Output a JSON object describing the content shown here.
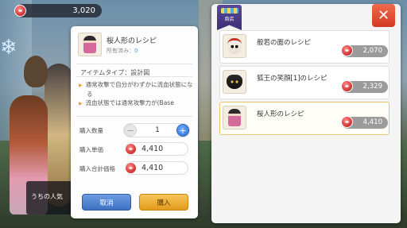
{
  "currency": {
    "amount": "3,020"
  },
  "chat": {
    "text": "うちの人気"
  },
  "detail": {
    "title": "桜人形のレシピ",
    "owned_label": "所有済み：",
    "owned_value": "0",
    "type": "アイテムタイプ：設計図",
    "description_lines": [
      "通常攻撃で自分がわずかに流血状態になる",
      "流血状態では通常攻撃力が(Base"
    ],
    "quantity_label": "購入数量",
    "quantity_value": "1",
    "unit_price_label": "購入単価",
    "unit_price_value": "4,410",
    "total_price_label": "購入合計価格",
    "total_price_value": "4,410",
    "cancel_label": "取消",
    "buy_label": "購入"
  },
  "shop": {
    "badge_label": "商店",
    "close_symbol": "✕",
    "items": [
      {
        "name": "般若の面のレシピ",
        "price": "2,070",
        "icon": "hannya-mask-icon",
        "selected": false
      },
      {
        "name": "狐王の笑顔[1]のレシピ",
        "price": "2,329",
        "icon": "fox-mask-icon",
        "selected": false
      },
      {
        "name": "桜人形のレシピ",
        "price": "4,410",
        "icon": "sakura-doll-icon",
        "selected": true
      }
    ]
  },
  "colors": {
    "buy_button": "#e39a1c",
    "cancel_button": "#3f71c4",
    "close_button": "#d23a22",
    "selected_border": "#e8c66a"
  }
}
